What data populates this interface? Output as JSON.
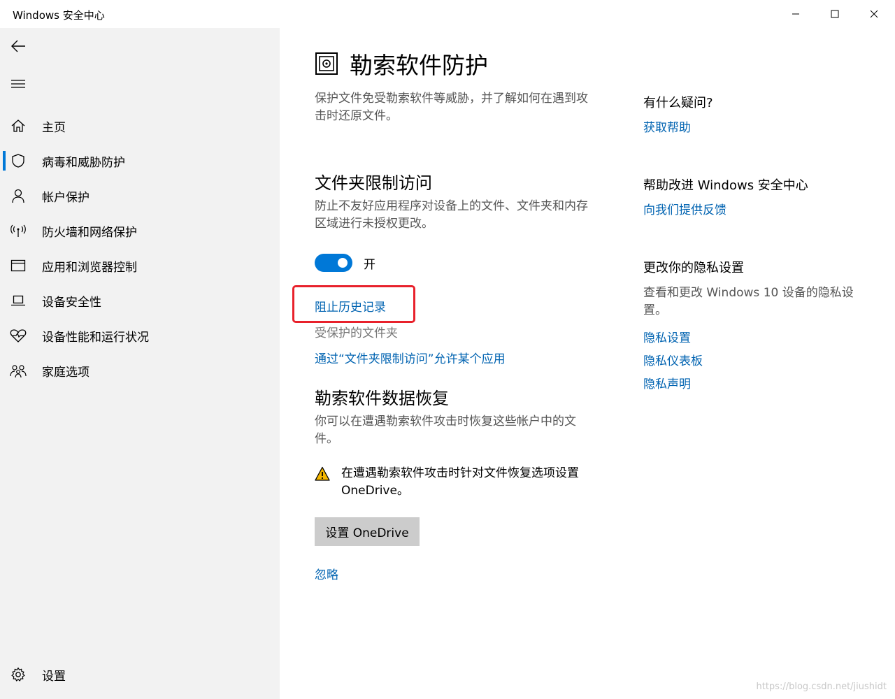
{
  "window": {
    "title": "Windows 安全中心",
    "minimize_icon": "minimize-icon",
    "maximize_icon": "maximize-icon",
    "close_icon": "close-icon"
  },
  "sidebar": {
    "back_icon": "back-arrow-icon",
    "menu_icon": "hamburger-icon",
    "items": [
      {
        "label": "主页",
        "icon": "home-icon"
      },
      {
        "label": "病毒和威胁防护",
        "icon": "shield-icon",
        "active": true
      },
      {
        "label": "帐户保护",
        "icon": "person-icon"
      },
      {
        "label": "防火墙和网络保护",
        "icon": "antenna-icon"
      },
      {
        "label": "应用和浏览器控制",
        "icon": "browser-window-icon"
      },
      {
        "label": "设备安全性",
        "icon": "laptop-icon"
      },
      {
        "label": "设备性能和运行状况",
        "icon": "heart-pulse-icon"
      },
      {
        "label": "家庭选项",
        "icon": "family-icon"
      }
    ],
    "settings": {
      "label": "设置",
      "icon": "gear-icon"
    }
  },
  "main": {
    "title": "勒索软件防护",
    "title_icon": "ransomware-folder-icon",
    "description": "保护文件免受勒索软件等威胁，并了解如何在遇到攻击时还原文件。",
    "cfa": {
      "title": "文件夹限制访问",
      "description": "防止不友好应用程序对设备上的文件、文件夹和内存区域进行未授权更改。",
      "toggle_label": "开",
      "toggle_on": true,
      "block_history_link": "阻止历史记录",
      "protected_folders": "受保护的文件夹",
      "allow_app_link": "通过“文件夹限制访问”允许某个应用"
    },
    "recovery": {
      "title": "勒索软件数据恢复",
      "description": "你可以在遭遇勒索软件攻击时恢复这些帐户中的文件。",
      "warning_icon": "warning-icon",
      "warning_text": "在遭遇勒索软件攻击时针对文件恢复选项设置 OneDrive。",
      "setup_button": "设置 OneDrive",
      "dismiss_link": "忽略"
    }
  },
  "right": {
    "question_title": "有什么疑问?",
    "get_help_link": "获取帮助",
    "improve_title": "帮助改进 Windows 安全中心",
    "feedback_link": "向我们提供反馈",
    "privacy_title": "更改你的隐私设置",
    "privacy_text": "查看和更改 Windows 10 设备的隐私设置。",
    "privacy_links": [
      "隐私设置",
      "隐私仪表板",
      "隐私声明"
    ]
  },
  "watermark": "https://blog.csdn.net/jiushidt",
  "colors": {
    "accent": "#0078d7",
    "link": "#0063b1",
    "sidebar_bg": "#f2f2f2",
    "highlight_border": "#e8212b",
    "warning": "#f5b700"
  }
}
